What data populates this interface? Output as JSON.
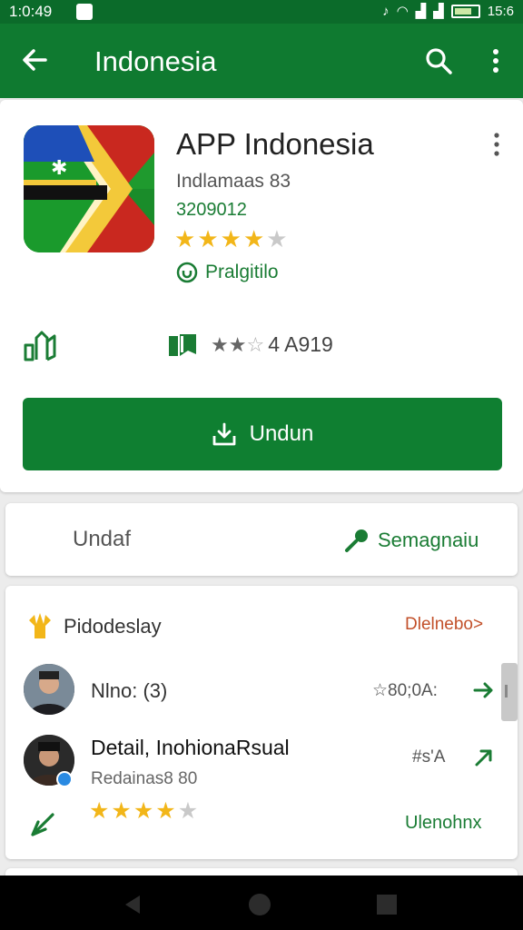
{
  "status_bar": {
    "time": "1:0:49",
    "battery_label": "15:6"
  },
  "app_bar": {
    "title": "Indonesia"
  },
  "app": {
    "name": "APP Indonesia",
    "developer": "Indlamaas 83",
    "subtitle": "3209012",
    "rating_stars": 4,
    "badge_label": "Pralgitilo",
    "meta_text": "4 A919",
    "meta_stars": 2.5,
    "install_label": "Undun"
  },
  "tabs_card": {
    "left_label": "Undaf",
    "right_label": "Semagnaiu"
  },
  "reviews": {
    "header": "Pidodeslay",
    "header_link": "Dlelnebo>",
    "items": [
      {
        "name": "Nlno: (3)",
        "meta": "☆80;0A:"
      },
      {
        "name": "Detail, InohionaRsual",
        "meta": "#s'A",
        "sub": "Redainas8 80",
        "stars": 4
      }
    ],
    "footer_link": "Ulenohnx"
  },
  "colors": {
    "primary": "#0f7a30",
    "accent_star": "#f2b619",
    "link_orange": "#c2502a"
  }
}
